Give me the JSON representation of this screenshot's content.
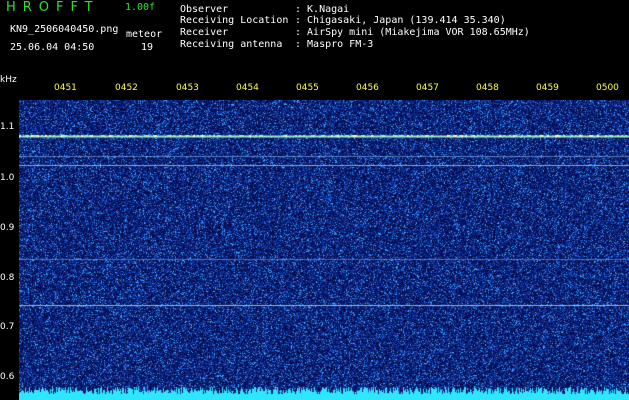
{
  "app": {
    "name": "HROFFT",
    "version": "1.00f"
  },
  "file": {
    "name": "KN9_2506040450.png",
    "datetime": "25.06.04 04:50",
    "mode": "meteor",
    "count": "19"
  },
  "info": [
    {
      "label": "Observer",
      "value": ": K.Nagai"
    },
    {
      "label": "Receiving Location",
      "value": ": Chigasaki, Japan (139.414 35.340)"
    },
    {
      "label": "Receiver",
      "value": ": AirSpy mini (Miakejima VOR 108.65MHz)"
    },
    {
      "label": "Receiving antenna",
      "value": ": Maspro FM-3"
    }
  ],
  "axis": {
    "y_unit": "kHz",
    "y_ticks": [
      "1.1",
      "1.0",
      "0.9",
      "0.8",
      "0.7",
      "0.6"
    ],
    "x_ticks": [
      "0451",
      "0452",
      "0453",
      "0454",
      "0455",
      "0456",
      "0457",
      "0458",
      "0459",
      "0500"
    ]
  },
  "colors": {
    "background": "#000000",
    "noise_dark": "#0a1a6a",
    "noise_bright": "#4fb0ff",
    "line": "#c8f0ff",
    "label": "#ffff40",
    "logo": "#2ee02e"
  }
}
